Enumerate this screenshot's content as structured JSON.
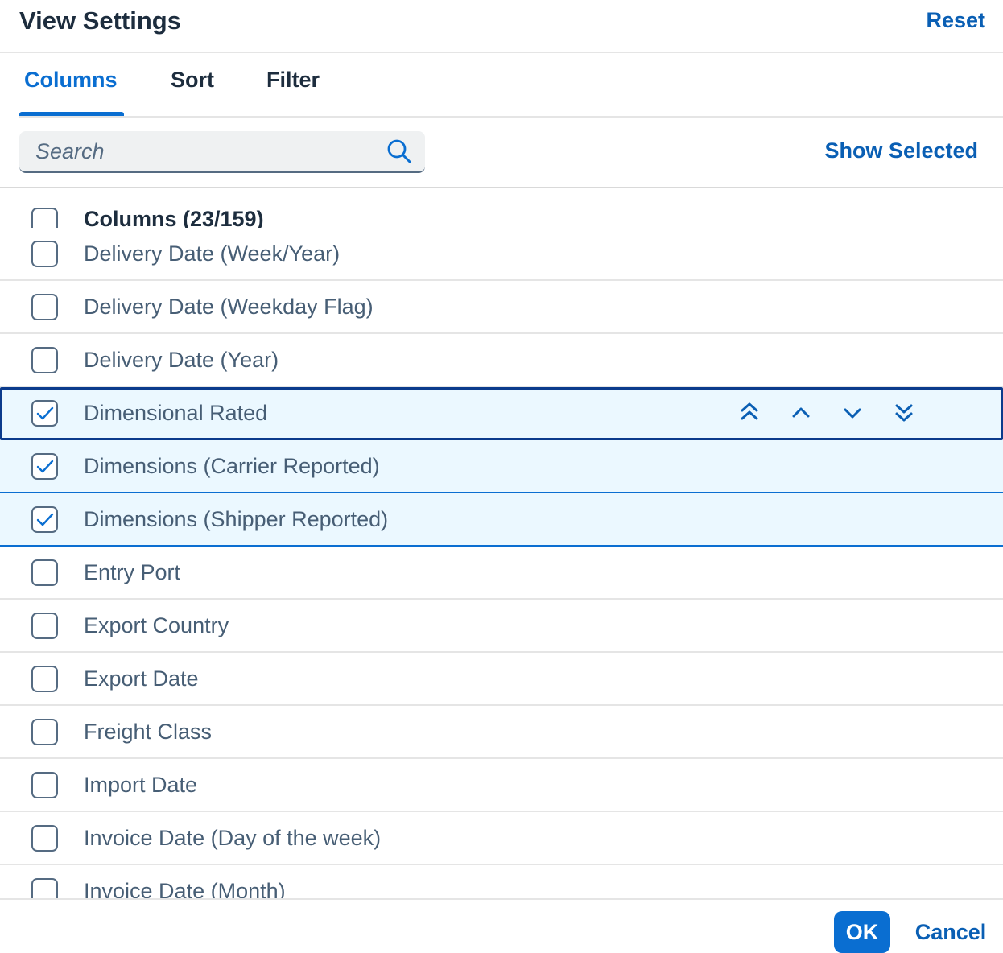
{
  "dialog": {
    "title": "View Settings",
    "reset_label": "Reset"
  },
  "tabs": [
    {
      "label": "Columns",
      "active": true
    },
    {
      "label": "Sort",
      "active": false
    },
    {
      "label": "Filter",
      "active": false
    }
  ],
  "search": {
    "placeholder": "Search",
    "value": ""
  },
  "show_selected_label": "Show Selected",
  "list_header": {
    "label": "Columns (23/159)",
    "checked": false
  },
  "columns": [
    {
      "label": "Delivery Date (Week/Year)",
      "checked": false
    },
    {
      "label": "Delivery Date (Weekday Flag)",
      "checked": false
    },
    {
      "label": "Delivery Date (Year)",
      "checked": false
    },
    {
      "label": "Dimensional Rated",
      "checked": true,
      "focused": true
    },
    {
      "label": "Dimensions (Carrier Reported)",
      "checked": true
    },
    {
      "label": "Dimensions (Shipper Reported)",
      "checked": true
    },
    {
      "label": "Entry Port",
      "checked": false
    },
    {
      "label": "Export Country",
      "checked": false
    },
    {
      "label": "Export Date",
      "checked": false
    },
    {
      "label": "Freight Class",
      "checked": false
    },
    {
      "label": "Import Date",
      "checked": false
    },
    {
      "label": "Invoice Date (Day of the week)",
      "checked": false
    },
    {
      "label": "Invoice Date (Month)",
      "checked": false
    }
  ],
  "row_actions": [
    "move-to-top-icon",
    "move-up-icon",
    "move-down-icon",
    "move-to-bottom-icon"
  ],
  "footer": {
    "ok_label": "OK",
    "cancel_label": "Cancel"
  },
  "colors": {
    "accent": "#0a6ed1",
    "link": "#0a5fb4",
    "selected_row": "#ebf8ff",
    "focus_border": "#0b3b8c"
  }
}
